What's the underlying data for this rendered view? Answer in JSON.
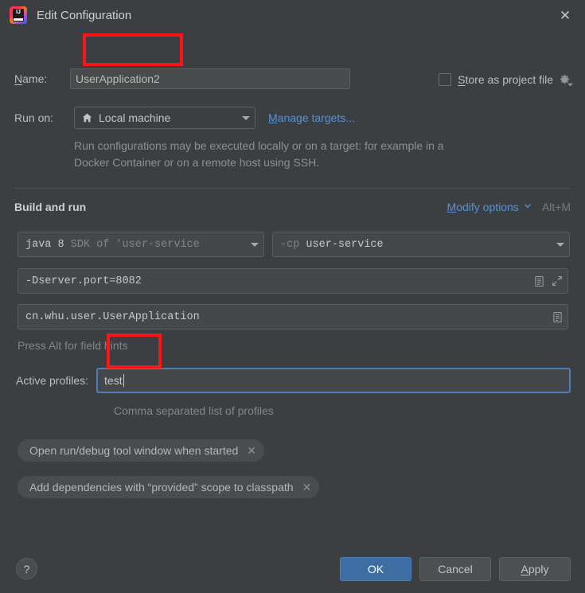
{
  "window": {
    "title": "Edit Configuration",
    "logo_icon": "intellij-idea-logo",
    "close_icon": "close-icon",
    "close_glyph": "✕"
  },
  "name_row": {
    "label": "Name:",
    "label_mnemonic": "N",
    "label_rest": "ame:",
    "value": "UserApplication2",
    "store_checkbox": {
      "label_mnemonic": "S",
      "label_rest": "tore as project file",
      "label": "Store as project file",
      "checked": false,
      "gear_icon": "gear-icon"
    }
  },
  "run_on": {
    "label": "Run on:",
    "selected": "Local machine",
    "target_icon": "home-icon",
    "manage_link": "Manage targets...",
    "manage_link_mnemonic": "M",
    "manage_link_rest": "anage targets...",
    "description": "Run configurations may be executed locally or on a target: for example in a Docker Container or on a remote host using SSH."
  },
  "build_and_run": {
    "section_title": "Build and run",
    "modify_options_mnemonic": "M",
    "modify_options_rest": "odify options",
    "modify_options": "Modify options",
    "chevron_icon": "chevron-down-icon",
    "chevron_glyph": "⌄",
    "shortcut": "Alt+M",
    "jre": {
      "primary": "java 8",
      "secondary": "SDK of 'user-service"
    },
    "classpath": {
      "prefix": "-cp",
      "module": "user-service"
    },
    "vm_options": {
      "value": "-Dserver.port=8082",
      "doc_icon": "document-icon",
      "expand_icon": "expand-icon"
    },
    "main_class": {
      "value": "cn.whu.user.UserApplication",
      "browse_icon": "document-icon"
    },
    "field_hint": "Press Alt for field hints"
  },
  "active_profiles": {
    "label": "Active profiles:",
    "value": "test",
    "hint": "Comma separated list of profiles"
  },
  "chips": [
    {
      "label": "Open run/debug tool window when started",
      "close_icon": "close-icon",
      "close_glyph": "✕"
    },
    {
      "label": "Add dependencies with “provided” scope to classpath",
      "close_icon": "close-icon",
      "close_glyph": "✕"
    }
  ],
  "footer": {
    "help_glyph": "?",
    "help_icon": "help-icon",
    "ok": "OK",
    "cancel": "Cancel",
    "apply_mnemonic": "A",
    "apply_rest": "pply",
    "apply": "Apply"
  },
  "colors": {
    "background": "#3c3f41",
    "accent_link": "#5791d4",
    "primary_button": "#3c6ea3",
    "focus_border": "#4c7eb5",
    "annotation": "#fd1414"
  }
}
